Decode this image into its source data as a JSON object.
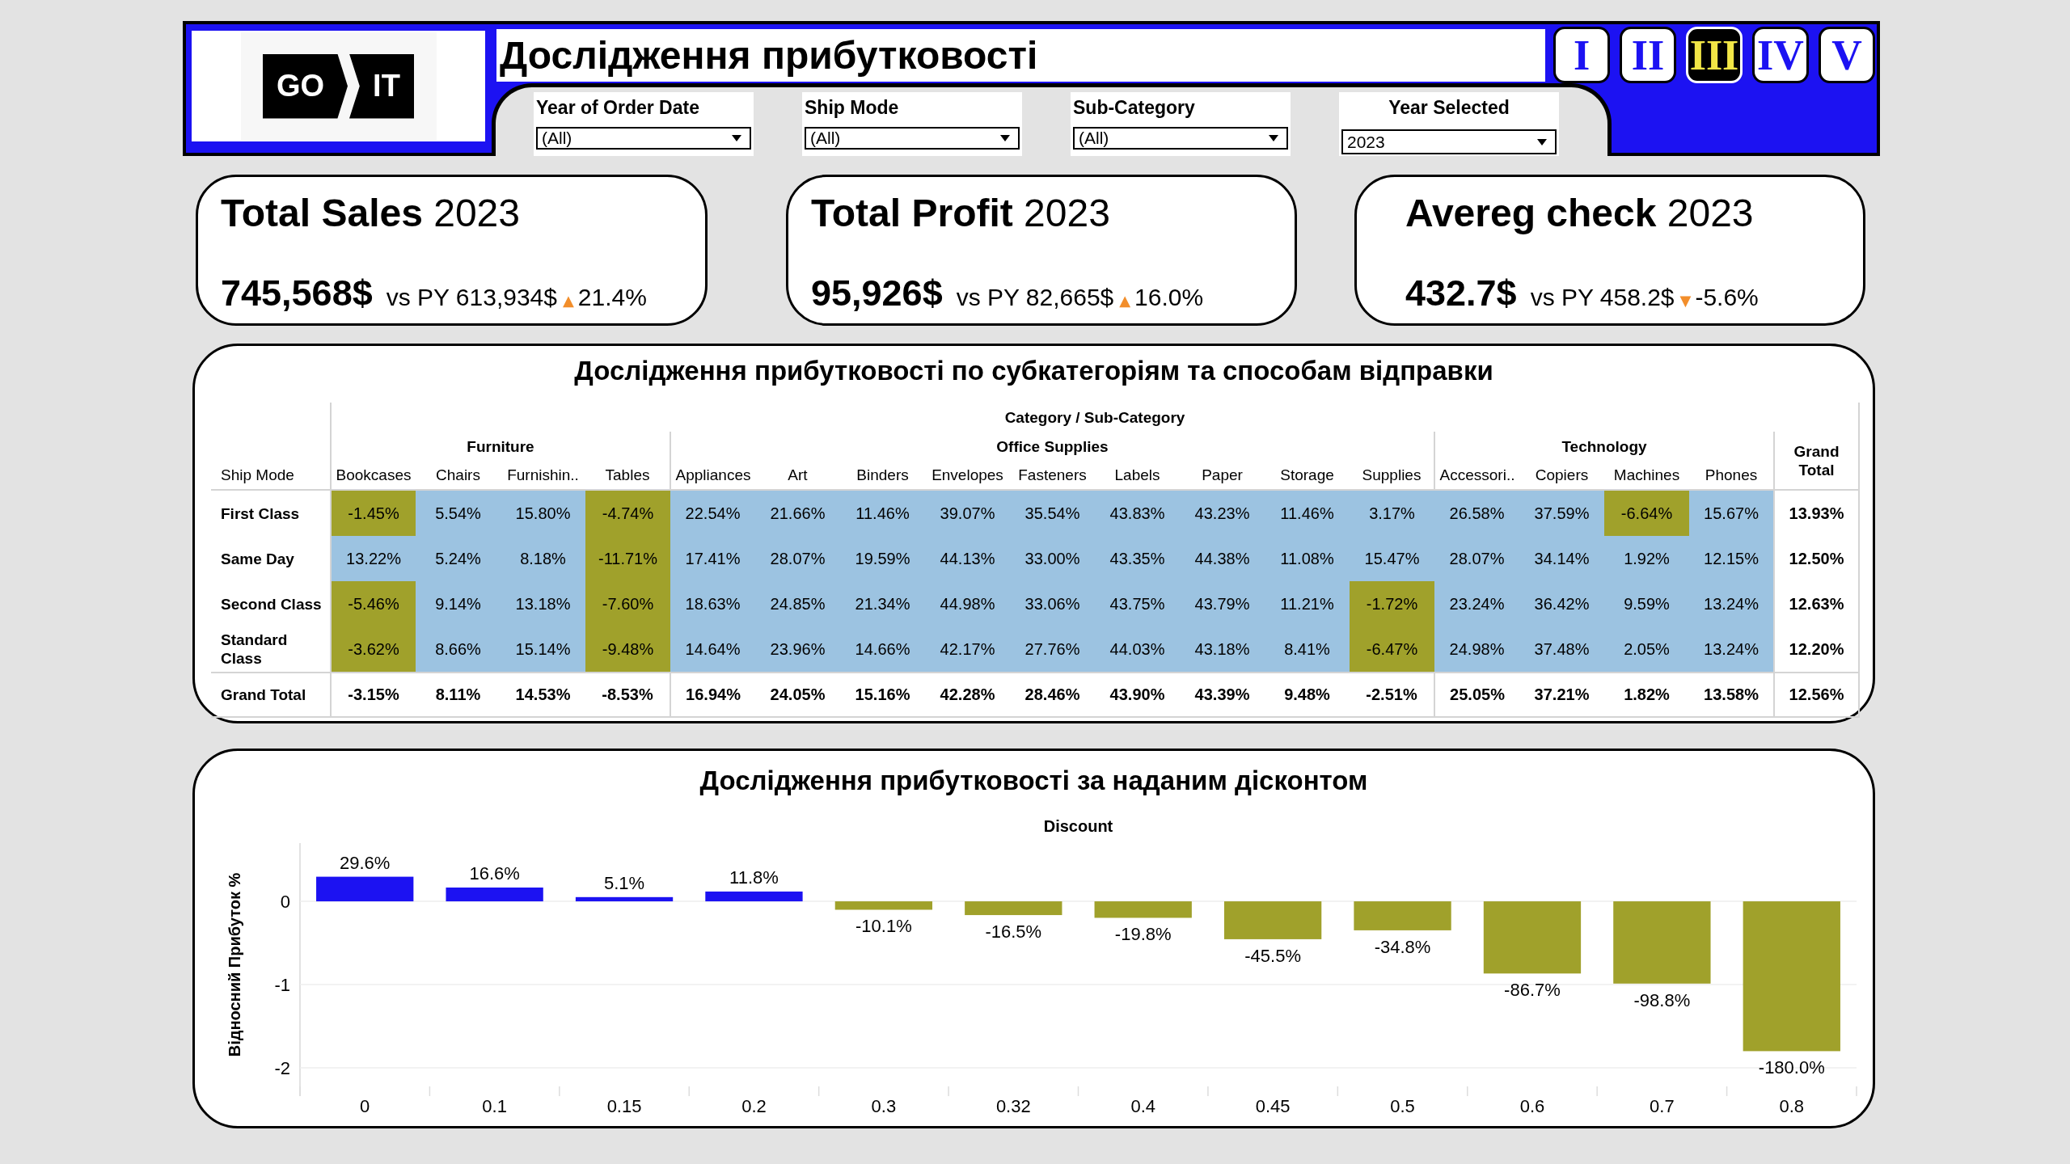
{
  "header": {
    "logo_text": [
      "GO",
      "IT"
    ],
    "title": "Дослідження прибутковості",
    "nav_buttons": [
      {
        "label": "I",
        "selected": false
      },
      {
        "label": "II",
        "selected": false
      },
      {
        "label": "III",
        "selected": true
      },
      {
        "label": "IV",
        "selected": false
      },
      {
        "label": "V",
        "selected": false
      }
    ]
  },
  "filters": [
    {
      "kind": "filter",
      "label": "Year of Order Date",
      "value": "(All)"
    },
    {
      "kind": "filter",
      "label": "Ship Mode",
      "value": "(All)"
    },
    {
      "kind": "filter",
      "label": "Sub-Category",
      "value": "(All)"
    },
    {
      "kind": "parameter",
      "label": "Year Selected",
      "value": "2023"
    }
  ],
  "kpis": [
    {
      "title": "**Total Sales** 2023",
      "value": "745,568$",
      "comparison": "vs PY 613,934$",
      "trend": "▲",
      "change": "21.4%"
    },
    {
      "title": "**Total Profit** 2023",
      "value": "95,926$",
      "comparison": "vs PY 82,665$",
      "trend": "▲",
      "change": "16.0%"
    },
    {
      "title": "**Avereg check** 2023",
      "value": "432.7$",
      "comparison": "vs PY 458.2$",
      "trend": "▼",
      "change": "-5.6%"
    }
  ],
  "profit_table": {
    "title": "Дослідження прибутковості по субкатегоріям та способам відправки",
    "axis_title": "Category / Sub-Category",
    "row_header_title": "Ship Mode",
    "total_label": "Grand Total",
    "categories": [
      {
        "name": "Furniture",
        "subcategories": [
          "Bookcases",
          "Chairs",
          "Furnishin..",
          "Tables"
        ]
      },
      {
        "name": "Office Supplies",
        "subcategories": [
          "Appliances",
          "Art",
          "Binders",
          "Envelopes",
          "Fasteners",
          "Labels",
          "Paper",
          "Storage",
          "Supplies"
        ]
      },
      {
        "name": "Technology",
        "subcategories": [
          "Accessori..",
          "Copiers",
          "Machines",
          "Phones"
        ]
      }
    ],
    "rows": [
      {
        "label": "First Class",
        "cells": [
          {
            "text": "-1.45%",
            "color": "#a0a12b"
          },
          {
            "text": "5.54%",
            "color": "#9cc3e1"
          },
          {
            "text": "15.80%",
            "color": "#9cc3e1"
          },
          {
            "text": "-4.74%",
            "color": "#a0a12b"
          },
          {
            "text": "22.54%",
            "color": "#9cc3e1"
          },
          {
            "text": "21.66%",
            "color": "#9cc3e1"
          },
          {
            "text": "11.46%",
            "color": "#9cc3e1"
          },
          {
            "text": "39.07%",
            "color": "#9cc3e1"
          },
          {
            "text": "35.54%",
            "color": "#9cc3e1"
          },
          {
            "text": "43.83%",
            "color": "#9cc3e1"
          },
          {
            "text": "43.23%",
            "color": "#9cc3e1"
          },
          {
            "text": "11.46%",
            "color": "#9cc3e1"
          },
          {
            "text": "3.17%",
            "color": "#9cc3e1"
          },
          {
            "text": "26.58%",
            "color": "#9cc3e1"
          },
          {
            "text": "37.59%",
            "color": "#9cc3e1"
          },
          {
            "text": "-6.64%",
            "color": "#a0a12b"
          },
          {
            "text": "15.67%",
            "color": "#9cc3e1"
          }
        ],
        "total": "13.93%"
      },
      {
        "label": "Same Day",
        "cells": [
          {
            "text": "13.22%",
            "color": "#9cc3e1"
          },
          {
            "text": "5.24%",
            "color": "#9cc3e1"
          },
          {
            "text": "8.18%",
            "color": "#9cc3e1"
          },
          {
            "text": "-11.71%",
            "color": "#a0a12b"
          },
          {
            "text": "17.41%",
            "color": "#9cc3e1"
          },
          {
            "text": "28.07%",
            "color": "#9cc3e1"
          },
          {
            "text": "19.59%",
            "color": "#9cc3e1"
          },
          {
            "text": "44.13%",
            "color": "#9cc3e1"
          },
          {
            "text": "33.00%",
            "color": "#9cc3e1"
          },
          {
            "text": "43.35%",
            "color": "#9cc3e1"
          },
          {
            "text": "44.38%",
            "color": "#9cc3e1"
          },
          {
            "text": "11.08%",
            "color": "#9cc3e1"
          },
          {
            "text": "15.47%",
            "color": "#9cc3e1"
          },
          {
            "text": "28.07%",
            "color": "#9cc3e1"
          },
          {
            "text": "34.14%",
            "color": "#9cc3e1"
          },
          {
            "text": "1.92%",
            "color": "#9cc3e1"
          },
          {
            "text": "12.15%",
            "color": "#9cc3e1"
          }
        ],
        "total": "12.50%"
      },
      {
        "label": "Second Class",
        "cells": [
          {
            "text": "-5.46%",
            "color": "#a0a12b"
          },
          {
            "text": "9.14%",
            "color": "#9cc3e1"
          },
          {
            "text": "13.18%",
            "color": "#9cc3e1"
          },
          {
            "text": "-7.60%",
            "color": "#a0a12b"
          },
          {
            "text": "18.63%",
            "color": "#9cc3e1"
          },
          {
            "text": "24.85%",
            "color": "#9cc3e1"
          },
          {
            "text": "21.34%",
            "color": "#9cc3e1"
          },
          {
            "text": "44.98%",
            "color": "#9cc3e1"
          },
          {
            "text": "33.06%",
            "color": "#9cc3e1"
          },
          {
            "text": "43.75%",
            "color": "#9cc3e1"
          },
          {
            "text": "43.79%",
            "color": "#9cc3e1"
          },
          {
            "text": "11.21%",
            "color": "#9cc3e1"
          },
          {
            "text": "-1.72%",
            "color": "#a0a12b"
          },
          {
            "text": "23.24%",
            "color": "#9cc3e1"
          },
          {
            "text": "36.42%",
            "color": "#9cc3e1"
          },
          {
            "text": "9.59%",
            "color": "#9cc3e1"
          },
          {
            "text": "13.24%",
            "color": "#9cc3e1"
          }
        ],
        "total": "12.63%"
      },
      {
        "label": "Standard Class",
        "cells": [
          {
            "text": "-3.62%",
            "color": "#a0a12b"
          },
          {
            "text": "8.66%",
            "color": "#9cc3e1"
          },
          {
            "text": "15.14%",
            "color": "#9cc3e1"
          },
          {
            "text": "-9.48%",
            "color": "#a0a12b"
          },
          {
            "text": "14.64%",
            "color": "#9cc3e1"
          },
          {
            "text": "23.96%",
            "color": "#9cc3e1"
          },
          {
            "text": "14.66%",
            "color": "#9cc3e1"
          },
          {
            "text": "42.17%",
            "color": "#9cc3e1"
          },
          {
            "text": "27.76%",
            "color": "#9cc3e1"
          },
          {
            "text": "44.03%",
            "color": "#9cc3e1"
          },
          {
            "text": "43.18%",
            "color": "#9cc3e1"
          },
          {
            "text": "8.41%",
            "color": "#9cc3e1"
          },
          {
            "text": "-6.47%",
            "color": "#a0a12b"
          },
          {
            "text": "24.98%",
            "color": "#9cc3e1"
          },
          {
            "text": "37.48%",
            "color": "#9cc3e1"
          },
          {
            "text": "2.05%",
            "color": "#9cc3e1"
          },
          {
            "text": "13.24%",
            "color": "#9cc3e1"
          }
        ],
        "total": "12.20%"
      }
    ],
    "total_row": {
      "label": "Grand Total",
      "values": [
        "-3.15%",
        "8.11%",
        "14.53%",
        "-8.53%",
        "16.94%",
        "24.05%",
        "15.16%",
        "42.28%",
        "28.46%",
        "43.90%",
        "43.39%",
        "9.48%",
        "-2.51%",
        "25.05%",
        "37.21%",
        "1.82%",
        "13.58%"
      ],
      "total": "12.56%"
    }
  },
  "discount_chart": {
    "chart_data": {
      "type": "bar",
      "title": "Дослідження прибутковості за наданим дісконтом",
      "xlabel": "Discount",
      "ylabel": "Відносний Прибуток %",
      "categories": [
        "0",
        "0.1",
        "0.15",
        "0.2",
        "0.3",
        "0.32",
        "0.4",
        "0.45",
        "0.5",
        "0.6",
        "0.7",
        "0.8"
      ],
      "values": [
        0.296,
        0.166,
        0.051,
        0.118,
        -0.101,
        -0.165,
        -0.198,
        -0.455,
        -0.348,
        -0.867,
        -0.988,
        -1.8
      ],
      "colors": [
        "#1c12f2",
        "#1c12f2",
        "#1c12f2",
        "#1c12f2",
        "#a0a12b",
        "#a0a12b",
        "#a0a12b",
        "#a0a12b",
        "#a0a12b",
        "#a0a12b",
        "#a0a12b",
        "#a0a12b"
      ],
      "value_labels": [
        "29.6%",
        "16.6%",
        "5.1%",
        "11.8%",
        "-10.1%",
        "-16.5%",
        "-19.8%",
        "-45.5%",
        "-34.8%",
        "-86.7%",
        "-98.8%",
        "-180.0%"
      ],
      "ylim": [
        -2.34,
        0.7
      ],
      "yticks": [
        0,
        -1,
        -2
      ],
      "grid": true
    }
  }
}
